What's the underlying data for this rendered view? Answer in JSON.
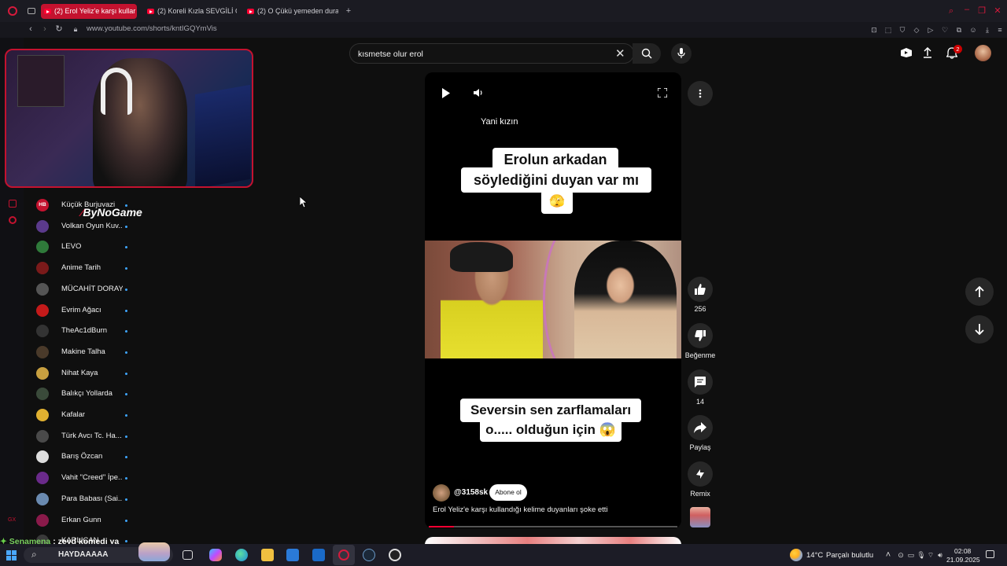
{
  "browser": {
    "tabs": [
      {
        "label": "(2) Erol Yeliz'e karşı kullar"
      },
      {
        "label": "(2) Koreli Kızla SEVGİLİ O"
      },
      {
        "label": "(2) O Çükü yemeden dura"
      }
    ],
    "url": "www.youtube.com/shorts/kntIGQYmVis"
  },
  "youtube": {
    "search": {
      "value": "kısmetse olur erol"
    },
    "notification_count": "2",
    "subscriptions": [
      {
        "name": "Küçük Burjuvazi",
        "color": "#c4122f",
        "initials": "HB"
      },
      {
        "name": "Volkan Oyun Kuv...",
        "color": "#5b3a8c",
        "initials": ""
      },
      {
        "name": "LEVO",
        "color": "#2f7a3a",
        "initials": ""
      },
      {
        "name": "Anime Tarih",
        "color": "#7a1a1a",
        "initials": ""
      },
      {
        "name": "MÜCAHİT DORAY",
        "color": "#555555",
        "initials": ""
      },
      {
        "name": "Evrim Ağacı",
        "color": "#c41a1a",
        "initials": ""
      },
      {
        "name": "TheAc1dBurn",
        "color": "#333333",
        "initials": ""
      },
      {
        "name": "Makine Talha",
        "color": "#4a3a2a",
        "initials": ""
      },
      {
        "name": "Nihat Kaya",
        "color": "#c8a040",
        "initials": ""
      },
      {
        "name": "Balıkçı Yollarda",
        "color": "#3a4a3a",
        "initials": ""
      },
      {
        "name": "Kafalar",
        "color": "#e0b030",
        "initials": ""
      },
      {
        "name": "Türk Avcı Tc. Ha...",
        "color": "#4a4a4a",
        "initials": ""
      },
      {
        "name": "Barış Özcan",
        "color": "#dddddd",
        "initials": ""
      },
      {
        "name": "Vahit \"Creed\" İpe...",
        "color": "#6a2a8a",
        "initials": ""
      },
      {
        "name": "Para Babası (Sai...",
        "color": "#6a8ab0",
        "initials": ""
      },
      {
        "name": "Erkan Gunn",
        "color": "#8a1a4a",
        "initials": ""
      },
      {
        "name": "KARLICAN",
        "color": "#3a3a3a",
        "initials": ""
      }
    ],
    "short": {
      "top_caption": "Yani kızın",
      "caption1_line1": "Erolun arkadan",
      "caption1_line2": "söylediğini duyan var mı",
      "caption1_emoji": "🫣",
      "caption2_line1": "Seversin sen zarflamaları",
      "caption2_line2": "o..... olduğun için 😱",
      "channel": "@3158sk",
      "subscribe_label": "Abone ol",
      "title": "Erol Yeliz'e karşı kullandığı kelime duyanları şoke etti",
      "progress": 0.1
    },
    "actions": {
      "likes": "256",
      "dislike_label": "Beğenme",
      "comments": "14",
      "share_label": "Paylaş",
      "remix_label": "Remix"
    }
  },
  "overlay": {
    "brand": "ByNoGame",
    "ticker_name": "Senamena",
    "ticker_text": "zeyd komedi ya",
    "ticker_sub": "HAYDAAAAA"
  },
  "taskbar": {
    "weather_temp": "14°C",
    "weather_text": "Parçalı bulutlu",
    "time": "02:08",
    "date": "21.09.2025"
  }
}
